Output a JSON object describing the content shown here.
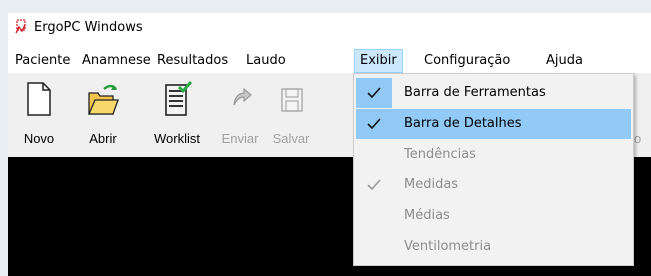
{
  "window": {
    "title": "ErgoPC Windows",
    "icon": "ergopc-app-icon"
  },
  "menubar": {
    "items": [
      {
        "label": "Paciente"
      },
      {
        "label": "Anamnese"
      },
      {
        "label": "Resultados"
      },
      {
        "label": "Laudo"
      },
      {
        "label": "Exibir",
        "active": true
      },
      {
        "label": "Configuração"
      },
      {
        "label": "Ajuda"
      }
    ]
  },
  "toolbar": {
    "buttons": [
      {
        "label": "Novo",
        "icon": "new-document-icon",
        "enabled": true
      },
      {
        "label": "Abrir",
        "icon": "open-folder-icon",
        "enabled": true
      },
      {
        "label": "Worklist",
        "icon": "worklist-icon",
        "enabled": true
      },
      {
        "label": "Enviar",
        "icon": "send-icon",
        "enabled": false
      },
      {
        "label": "Salvar",
        "icon": "save-icon",
        "enabled": false
      }
    ],
    "partially_hidden_label": "o"
  },
  "exibir_menu": {
    "items": [
      {
        "label": "Barra de Ferramentas",
        "checked": true,
        "enabled": true
      },
      {
        "label": "Barra de Detalhes",
        "checked": true,
        "enabled": true
      },
      {
        "label": "Tendências",
        "checked": false,
        "enabled": false
      },
      {
        "label": "Medidas",
        "checked": true,
        "enabled": false
      },
      {
        "label": "Médias",
        "checked": false,
        "enabled": false
      },
      {
        "label": "Ventilometria",
        "checked": false,
        "enabled": false
      }
    ]
  },
  "colors": {
    "menu_active_bg": "#cce8ff",
    "menu_item_hover": "#91c9f7",
    "content_bg": "#000000",
    "toolbar_bg": "#f0f0f0"
  }
}
